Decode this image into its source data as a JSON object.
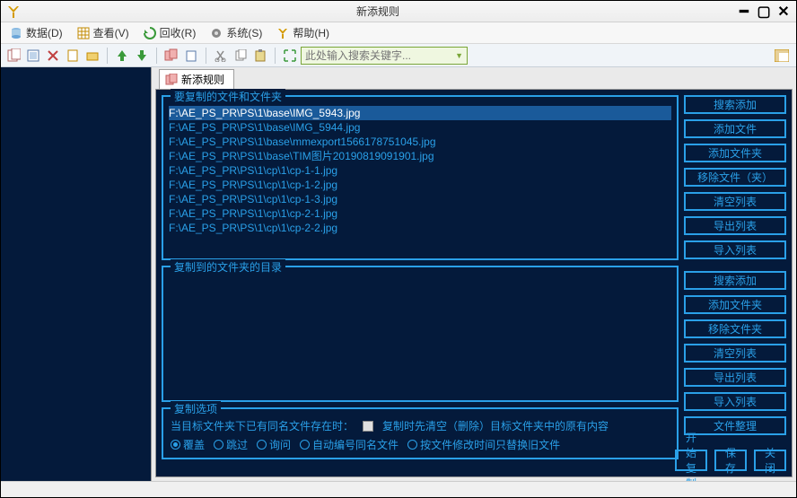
{
  "window": {
    "title": "新添规则"
  },
  "menu": {
    "data": "数据(D)",
    "view": "查看(V)",
    "recycle": "回收(R)",
    "system": "系统(S)",
    "help": "帮助(H)"
  },
  "toolbar": {
    "search_placeholder": "此处输入搜索关键字..."
  },
  "tab": {
    "label": "新添规则"
  },
  "groups": {
    "source": {
      "title": "要复制的文件和文件夹"
    },
    "dest": {
      "title": "复制到的文件夹的目录"
    },
    "opts": {
      "title": "复制选项"
    }
  },
  "files": [
    "F:\\AE_PS_PR\\PS\\1\\base\\IMG_5943.jpg",
    "F:\\AE_PS_PR\\PS\\1\\base\\IMG_5944.jpg",
    "F:\\AE_PS_PR\\PS\\1\\base\\mmexport1566178751045.jpg",
    "F:\\AE_PS_PR\\PS\\1\\base\\TIM图片20190819091901.jpg",
    "F:\\AE_PS_PR\\PS\\1\\cp\\1\\cp-1-1.jpg",
    "F:\\AE_PS_PR\\PS\\1\\cp\\1\\cp-1-2.jpg",
    "F:\\AE_PS_PR\\PS\\1\\cp\\1\\cp-1-3.jpg",
    "F:\\AE_PS_PR\\PS\\1\\cp\\1\\cp-2-1.jpg",
    "F:\\AE_PS_PR\\PS\\1\\cp\\1\\cp-2-2.jpg"
  ],
  "side_source": {
    "search_add": "搜索添加",
    "add_file": "添加文件",
    "add_folder": "添加文件夹",
    "remove": "移除文件（夹）",
    "clear": "清空列表",
    "export": "导出列表",
    "import": "导入列表"
  },
  "side_dest": {
    "search_add": "搜索添加",
    "add_folder": "添加文件夹",
    "remove": "移除文件夹",
    "clear": "清空列表",
    "export": "导出列表",
    "import": "导入列表",
    "organize": "文件整理"
  },
  "options": {
    "header": "当目标文件夹下已有同名文件存在时：",
    "clear_first": "复制时先清空（删除）目标文件夹中的原有内容",
    "overwrite": "覆盖",
    "skip": "跳过",
    "ask": "询问",
    "autonum": "自动编号同名文件",
    "newer": "按文件修改时间只替换旧文件"
  },
  "footer": {
    "start": "开始复制",
    "save": "保存",
    "close": "关闭"
  },
  "colors": {
    "accent": "#2aa0e8",
    "bg_dark": "#041a3b"
  }
}
